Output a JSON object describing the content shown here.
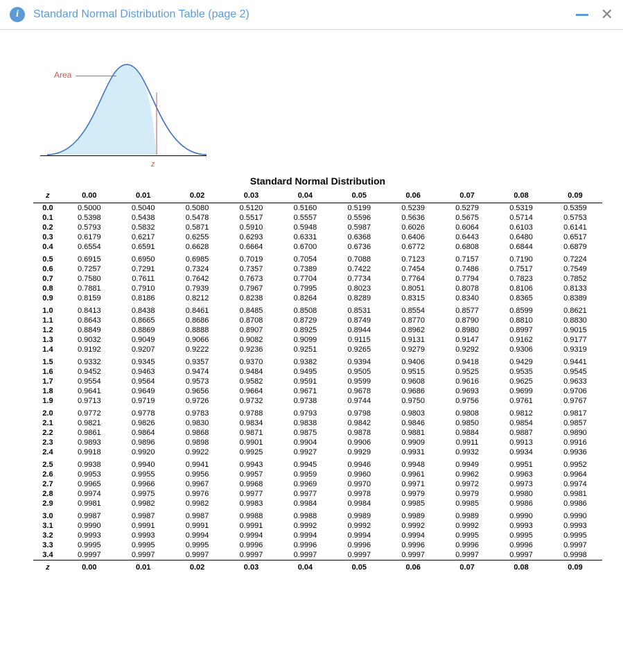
{
  "titlebar": {
    "title": "Standard Normal Distribution Table (page 2)"
  },
  "diagram": {
    "area_label": "Area",
    "z_label": "z"
  },
  "table": {
    "title": "Standard Normal Distribution",
    "z_header": "z",
    "col_headers": [
      "0.00",
      "0.01",
      "0.02",
      "0.03",
      "0.04",
      "0.05",
      "0.06",
      "0.07",
      "0.08",
      "0.09"
    ],
    "groups": [
      [
        {
          "z": "0.0",
          "v": [
            "0.5000",
            "0.5040",
            "0.5080",
            "0.5120",
            "0.5160",
            "0.5199",
            "0.5239",
            "0.5279",
            "0.5319",
            "0.5359"
          ]
        },
        {
          "z": "0.1",
          "v": [
            "0.5398",
            "0.5438",
            "0.5478",
            "0.5517",
            "0.5557",
            "0.5596",
            "0.5636",
            "0.5675",
            "0.5714",
            "0.5753"
          ]
        },
        {
          "z": "0.2",
          "v": [
            "0.5793",
            "0.5832",
            "0.5871",
            "0.5910",
            "0.5948",
            "0.5987",
            "0.6026",
            "0.6064",
            "0.6103",
            "0.6141"
          ]
        },
        {
          "z": "0.3",
          "v": [
            "0.6179",
            "0.6217",
            "0.6255",
            "0.6293",
            "0.6331",
            "0.6368",
            "0.6406",
            "0.6443",
            "0.6480",
            "0.6517"
          ]
        },
        {
          "z": "0.4",
          "v": [
            "0.6554",
            "0.6591",
            "0.6628",
            "0.6664",
            "0.6700",
            "0.6736",
            "0.6772",
            "0.6808",
            "0.6844",
            "0.6879"
          ]
        }
      ],
      [
        {
          "z": "0.5",
          "v": [
            "0.6915",
            "0.6950",
            "0.6985",
            "0.7019",
            "0.7054",
            "0.7088",
            "0.7123",
            "0.7157",
            "0.7190",
            "0.7224"
          ]
        },
        {
          "z": "0.6",
          "v": [
            "0.7257",
            "0.7291",
            "0.7324",
            "0.7357",
            "0.7389",
            "0.7422",
            "0.7454",
            "0.7486",
            "0.7517",
            "0.7549"
          ]
        },
        {
          "z": "0.7",
          "v": [
            "0.7580",
            "0.7611",
            "0.7642",
            "0.7673",
            "0.7704",
            "0.7734",
            "0.7764",
            "0.7794",
            "0.7823",
            "0.7852"
          ]
        },
        {
          "z": "0.8",
          "v": [
            "0.7881",
            "0.7910",
            "0.7939",
            "0.7967",
            "0.7995",
            "0.8023",
            "0.8051",
            "0.8078",
            "0.8106",
            "0.8133"
          ]
        },
        {
          "z": "0.9",
          "v": [
            "0.8159",
            "0.8186",
            "0.8212",
            "0.8238",
            "0.8264",
            "0.8289",
            "0.8315",
            "0.8340",
            "0.8365",
            "0.8389"
          ]
        }
      ],
      [
        {
          "z": "1.0",
          "v": [
            "0.8413",
            "0.8438",
            "0.8461",
            "0.8485",
            "0.8508",
            "0.8531",
            "0.8554",
            "0.8577",
            "0.8599",
            "0.8621"
          ]
        },
        {
          "z": "1.1",
          "v": [
            "0.8643",
            "0.8665",
            "0.8686",
            "0.8708",
            "0.8729",
            "0.8749",
            "0.8770",
            "0.8790",
            "0.8810",
            "0.8830"
          ]
        },
        {
          "z": "1.2",
          "v": [
            "0.8849",
            "0.8869",
            "0.8888",
            "0.8907",
            "0.8925",
            "0.8944",
            "0.8962",
            "0.8980",
            "0.8997",
            "0.9015"
          ]
        },
        {
          "z": "1.3",
          "v": [
            "0.9032",
            "0.9049",
            "0.9066",
            "0.9082",
            "0.9099",
            "0.9115",
            "0.9131",
            "0.9147",
            "0.9162",
            "0.9177"
          ]
        },
        {
          "z": "1.4",
          "v": [
            "0.9192",
            "0.9207",
            "0.9222",
            "0.9236",
            "0.9251",
            "0.9265",
            "0.9279",
            "0.9292",
            "0.9306",
            "0.9319"
          ]
        }
      ],
      [
        {
          "z": "1.5",
          "v": [
            "0.9332",
            "0.9345",
            "0.9357",
            "0.9370",
            "0.9382",
            "0.9394",
            "0.9406",
            "0.9418",
            "0.9429",
            "0.9441"
          ]
        },
        {
          "z": "1.6",
          "v": [
            "0.9452",
            "0.9463",
            "0.9474",
            "0.9484",
            "0.9495",
            "0.9505",
            "0.9515",
            "0.9525",
            "0.9535",
            "0.9545"
          ]
        },
        {
          "z": "1.7",
          "v": [
            "0.9554",
            "0.9564",
            "0.9573",
            "0.9582",
            "0.9591",
            "0.9599",
            "0.9608",
            "0.9616",
            "0.9625",
            "0.9633"
          ]
        },
        {
          "z": "1.8",
          "v": [
            "0.9641",
            "0.9649",
            "0.9656",
            "0.9664",
            "0.9671",
            "0.9678",
            "0.9686",
            "0.9693",
            "0.9699",
            "0.9706"
          ]
        },
        {
          "z": "1.9",
          "v": [
            "0.9713",
            "0.9719",
            "0.9726",
            "0.9732",
            "0.9738",
            "0.9744",
            "0.9750",
            "0.9756",
            "0.9761",
            "0.9767"
          ]
        }
      ],
      [
        {
          "z": "2.0",
          "v": [
            "0.9772",
            "0.9778",
            "0.9783",
            "0.9788",
            "0.9793",
            "0.9798",
            "0.9803",
            "0.9808",
            "0.9812",
            "0.9817"
          ]
        },
        {
          "z": "2.1",
          "v": [
            "0.9821",
            "0.9826",
            "0.9830",
            "0.9834",
            "0.9838",
            "0.9842",
            "0.9846",
            "0.9850",
            "0.9854",
            "0.9857"
          ]
        },
        {
          "z": "2.2",
          "v": [
            "0.9861",
            "0.9864",
            "0.9868",
            "0.9871",
            "0.9875",
            "0.9878",
            "0.9881",
            "0.9884",
            "0.9887",
            "0.9890"
          ]
        },
        {
          "z": "2.3",
          "v": [
            "0.9893",
            "0.9896",
            "0.9898",
            "0.9901",
            "0.9904",
            "0.9906",
            "0.9909",
            "0.9911",
            "0.9913",
            "0.9916"
          ]
        },
        {
          "z": "2.4",
          "v": [
            "0.9918",
            "0.9920",
            "0.9922",
            "0.9925",
            "0.9927",
            "0.9929",
            "0.9931",
            "0.9932",
            "0.9934",
            "0.9936"
          ]
        }
      ],
      [
        {
          "z": "2.5",
          "v": [
            "0.9938",
            "0.9940",
            "0.9941",
            "0.9943",
            "0.9945",
            "0.9946",
            "0.9948",
            "0.9949",
            "0.9951",
            "0.9952"
          ]
        },
        {
          "z": "2.6",
          "v": [
            "0.9953",
            "0.9955",
            "0.9956",
            "0.9957",
            "0.9959",
            "0.9960",
            "0.9961",
            "0.9962",
            "0.9963",
            "0.9964"
          ]
        },
        {
          "z": "2.7",
          "v": [
            "0.9965",
            "0.9966",
            "0.9967",
            "0.9968",
            "0.9969",
            "0.9970",
            "0.9971",
            "0.9972",
            "0.9973",
            "0.9974"
          ]
        },
        {
          "z": "2.8",
          "v": [
            "0.9974",
            "0.9975",
            "0.9976",
            "0.9977",
            "0.9977",
            "0.9978",
            "0.9979",
            "0.9979",
            "0.9980",
            "0.9981"
          ]
        },
        {
          "z": "2.9",
          "v": [
            "0.9981",
            "0.9982",
            "0.9982",
            "0.9983",
            "0.9984",
            "0.9984",
            "0.9985",
            "0.9985",
            "0.9986",
            "0.9986"
          ]
        }
      ],
      [
        {
          "z": "3.0",
          "v": [
            "0.9987",
            "0.9987",
            "0.9987",
            "0.9988",
            "0.9988",
            "0.9989",
            "0.9989",
            "0.9989",
            "0.9990",
            "0.9990"
          ]
        },
        {
          "z": "3.1",
          "v": [
            "0.9990",
            "0.9991",
            "0.9991",
            "0.9991",
            "0.9992",
            "0.9992",
            "0.9992",
            "0.9992",
            "0.9993",
            "0.9993"
          ]
        },
        {
          "z": "3.2",
          "v": [
            "0.9993",
            "0.9993",
            "0.9994",
            "0.9994",
            "0.9994",
            "0.9994",
            "0.9994",
            "0.9995",
            "0.9995",
            "0.9995"
          ]
        },
        {
          "z": "3.3",
          "v": [
            "0.9995",
            "0.9995",
            "0.9995",
            "0.9996",
            "0.9996",
            "0.9996",
            "0.9996",
            "0.9996",
            "0.9996",
            "0.9997"
          ]
        },
        {
          "z": "3.4",
          "v": [
            "0.9997",
            "0.9997",
            "0.9997",
            "0.9997",
            "0.9997",
            "0.9997",
            "0.9997",
            "0.9997",
            "0.9997",
            "0.9998"
          ]
        }
      ]
    ]
  }
}
